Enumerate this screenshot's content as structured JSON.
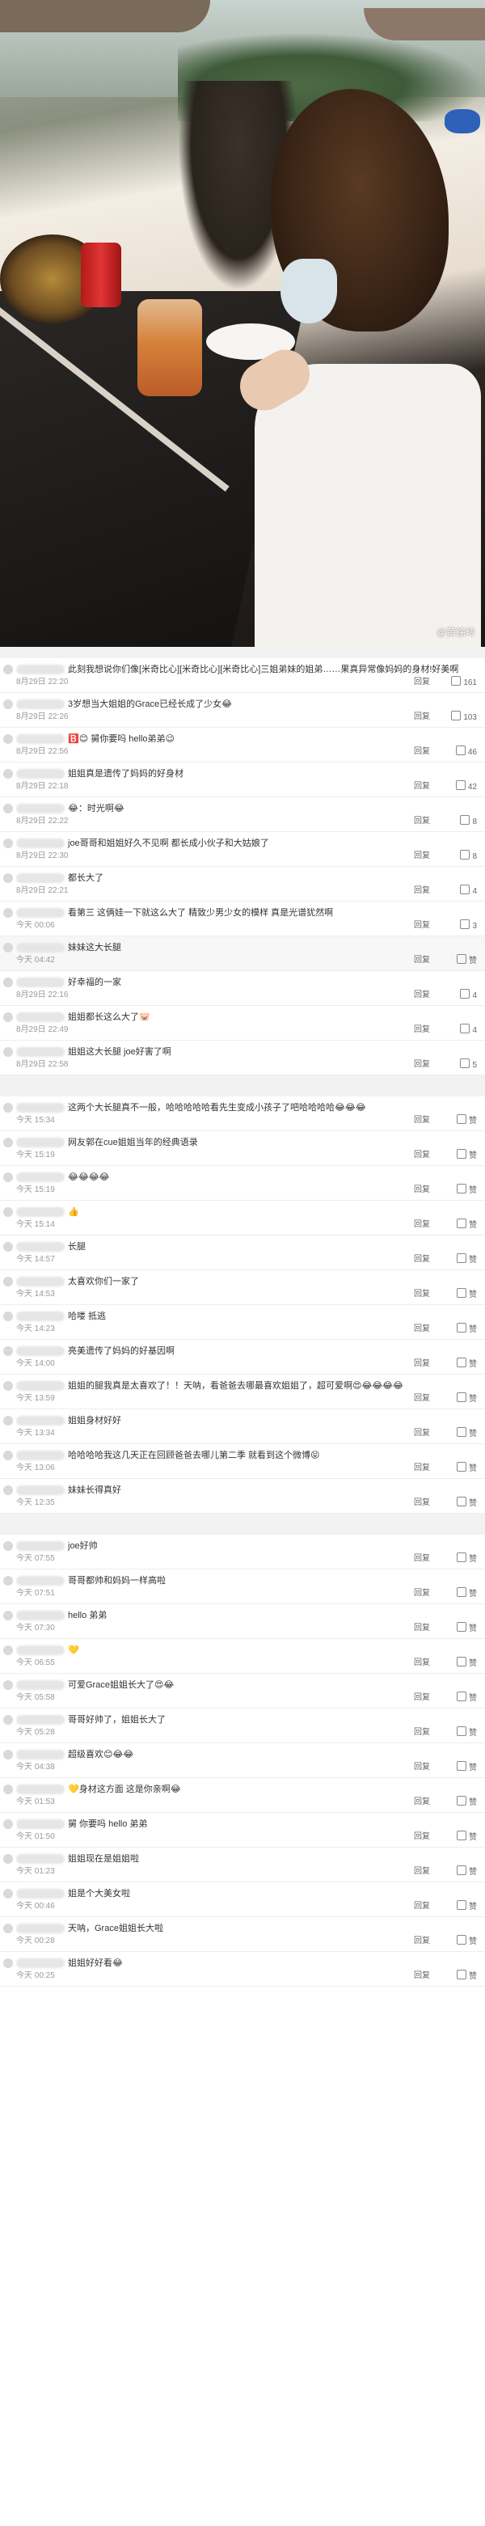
{
  "photo": {
    "watermark": "@黄徐玲",
    "accent_clip_color": "#2e62b8"
  },
  "ui": {
    "reply": "回复",
    "like_default": "赞"
  },
  "section1": [
    {
      "text": "此刻我想说你们像[米奇比心][米奇比心][米奇比心]三姐弟妹的姐弟……果真异常像妈妈的身材!好美啊",
      "time": "8月29日 22:20",
      "likes": "161"
    },
    {
      "text": "3岁想当大姐姐的Grace已经长成了少女😂",
      "time": "8月29日 22:26",
      "likes": "103"
    },
    {
      "text": "🅱️😊 舅你要吗 hello弟弟😉",
      "time": "8月29日 22:56",
      "likes": "46"
    },
    {
      "text": "姐姐真是遗传了妈妈的好身材",
      "time": "8月29日 22:18",
      "likes": "42"
    },
    {
      "text": "😂：时光啊😂",
      "time": "8月29日 22:22",
      "likes": "8"
    },
    {
      "text": "joe哥哥和姐姐好久不见啊 都长成小伙子和大姑娘了",
      "time": "8月29日 22:30",
      "likes": "8"
    },
    {
      "text": "都长大了",
      "time": "8月29日 22:21",
      "likes": "4"
    },
    {
      "text": "看第三 这俩娃一下就这么大了 精致少男少女的模样 真是光谱犹然啊",
      "time": "今天 00:06",
      "likes": "3"
    },
    {
      "text": "妹妹这大长腿",
      "time": "今天 04:42",
      "likes": "赞",
      "grey": true
    },
    {
      "text": "好幸福的一家",
      "time": "8月29日 22:16",
      "likes": "4"
    },
    {
      "text": "姐姐都长这么大了🐷",
      "time": "8月29日 22:49",
      "likes": "4"
    },
    {
      "text": "姐姐这大长腿 joe好害了啊",
      "time": "8月29日 22:58",
      "likes": "5"
    }
  ],
  "section2": [
    {
      "text": "这两个大长腿真不一般，哈哈哈哈哈看先生变成小孩子了吧哈哈哈哈😂😂😂",
      "time": "今天 15:34",
      "likes": "赞"
    },
    {
      "text": "网友郭在cue姐姐当年的经典语录",
      "time": "今天 15:19",
      "likes": "赞"
    },
    {
      "text": "😂😂😂😂",
      "time": "今天 15:19",
      "likes": "赞"
    },
    {
      "text": "👍",
      "time": "今天 15:14",
      "likes": "赞"
    },
    {
      "text": "长腿",
      "time": "今天 14:57",
      "likes": "赞"
    },
    {
      "text": "太喜欢你们一家了",
      "time": "今天 14:53",
      "likes": "赞"
    },
    {
      "text": "哈喽 抵逃",
      "time": "今天 14:23",
      "likes": "赞"
    },
    {
      "text": "亮美遗传了妈妈的好基因啊",
      "time": "今天 14:00",
      "likes": "赞"
    },
    {
      "text": "姐姐的腿我真是太喜欢了！！天呐，看爸爸去哪最喜欢姐姐了，超可爱啊😍😂😂😂😂",
      "time": "今天 13:59",
      "likes": "赞"
    },
    {
      "text": "姐姐身材好好",
      "time": "今天 13:34",
      "likes": "赞"
    },
    {
      "text": "哈哈哈哈我这几天正在回顾爸爸去哪儿第二季 就看到这个微博😝",
      "time": "今天 13:06",
      "likes": "赞"
    },
    {
      "text": "妹妹长得真好",
      "time": "今天 12:35",
      "likes": "赞"
    }
  ],
  "section3": [
    {
      "text": "joe好帅",
      "time": "今天 07:55",
      "likes": "赞"
    },
    {
      "text": "哥哥都帅和妈妈一样高啦",
      "time": "今天 07:51",
      "likes": "赞"
    },
    {
      "text": "hello 弟弟",
      "time": "今天 07:30",
      "likes": "赞"
    },
    {
      "text": "💛",
      "time": "今天 06:55",
      "likes": "赞"
    },
    {
      "text": "可爱Grace姐姐长大了😍😂",
      "time": "今天 05:58",
      "likes": "赞"
    },
    {
      "text": "哥哥好帅了，姐姐长大了",
      "time": "今天 05:28",
      "likes": "赞"
    },
    {
      "text": "超级喜欢😊😂😂",
      "time": "今天 04:38",
      "likes": "赞"
    },
    {
      "text": "💛身材这方面 这是你亲啊😂",
      "time": "今天 01:53",
      "likes": "赞"
    },
    {
      "text": "舅 你要吗 hello 弟弟",
      "time": "今天 01:50",
      "likes": "赞"
    },
    {
      "text": "姐姐现在是姐姐啦",
      "time": "今天 01:23",
      "likes": "赞"
    },
    {
      "text": "姐是个大美女啦",
      "time": "今天 00:46",
      "likes": "赞"
    },
    {
      "text": "天呐，Grace姐姐长大啦",
      "time": "今天 00:28",
      "likes": "赞"
    },
    {
      "text": "姐姐好好看😂",
      "time": "今天 00:25",
      "likes": "赞"
    }
  ]
}
